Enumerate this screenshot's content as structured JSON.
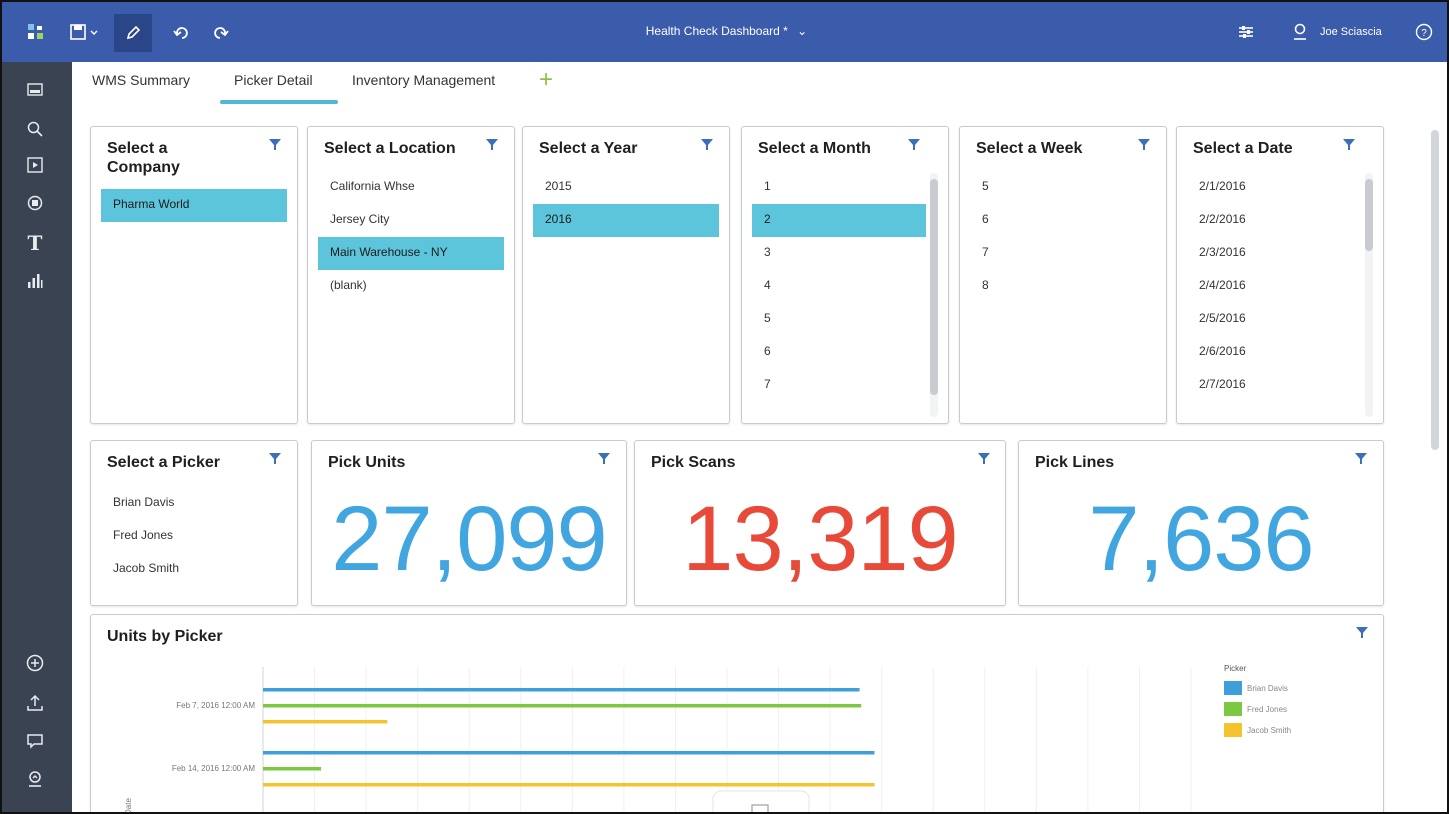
{
  "colors": {
    "topbar": "#3b5bab",
    "sidebar": "#3a4352",
    "selection": "#5dc5db",
    "kpi_blue": "#41a5e0",
    "kpi_red": "#e84a3a",
    "bar_blue": "#3f9fdb",
    "bar_green": "#7dc843",
    "bar_yellow": "#f4c430"
  },
  "topbar": {
    "title": "Health Check Dashboard *",
    "user": "Joe Sciascia"
  },
  "tabs": [
    {
      "label": "WMS Summary"
    },
    {
      "label": "Picker Detail"
    },
    {
      "label": "Inventory Management"
    }
  ],
  "filters": {
    "company": {
      "title": "Select a Company",
      "items": [
        "Pharma World"
      ],
      "selected": 0
    },
    "location": {
      "title": "Select a Location",
      "items": [
        "California Whse",
        "Jersey City",
        "Main Warehouse - NY",
        "(blank)"
      ],
      "selected": 2
    },
    "year": {
      "title": "Select a Year",
      "items": [
        "2015",
        "2016"
      ],
      "selected": 1
    },
    "month": {
      "title": "Select a Month",
      "items": [
        "1",
        "2",
        "3",
        "4",
        "5",
        "6",
        "7"
      ],
      "selected": 1
    },
    "week": {
      "title": "Select a Week",
      "items": [
        "5",
        "6",
        "7",
        "8"
      ]
    },
    "date": {
      "title": "Select a Date",
      "items": [
        "2/1/2016",
        "2/2/2016",
        "2/3/2016",
        "2/4/2016",
        "2/5/2016",
        "2/6/2016",
        "2/7/2016"
      ]
    },
    "picker": {
      "title": "Select a Picker",
      "items": [
        "Brian Davis",
        "Fred Jones",
        "Jacob Smith"
      ]
    }
  },
  "kpis": {
    "units": {
      "title": "Pick Units",
      "value": "27,099"
    },
    "scans": {
      "title": "Pick Scans",
      "value": "13,319"
    },
    "lines": {
      "title": "Pick Lines",
      "value": "7,636"
    }
  },
  "chart_panel": {
    "title": "Units by Picker"
  },
  "chart_data": {
    "type": "bar",
    "orientation": "horizontal",
    "title": "Units by Picker",
    "ylabel": "Date",
    "categories": [
      "Feb 7, 2016 12:00 AM",
      "Feb 14, 2016 12:00 AM"
    ],
    "legend_title": "Picker",
    "legend_position": "right",
    "grid": true,
    "xlim": [
      0,
      1120
    ],
    "series": [
      {
        "name": "Brian Davis",
        "color": "#3f9fdb",
        "values": [
          720,
          738
        ]
      },
      {
        "name": "Fred Jones",
        "color": "#7dc843",
        "values": [
          722,
          70
        ]
      },
      {
        "name": "Jacob Smith",
        "color": "#f4c430",
        "values": [
          150,
          738
        ]
      }
    ]
  }
}
